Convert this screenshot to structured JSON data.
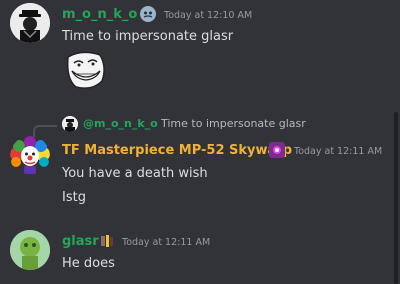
{
  "messages": [
    {
      "author": "m_o_n_k_o",
      "author_color": "#23a55a",
      "timestamp": "Today at 12:10 AM",
      "lines": [
        "Time to impersonate glasr"
      ],
      "attachment": "trollface-sticker"
    },
    {
      "reply_to": {
        "author": "@m_o_n_k_o",
        "text": "Time to impersonate glasr"
      },
      "author": "TF Masterpiece MP-52 Skywarp",
      "author_color": "#f0b232",
      "timestamp": "Today at 12:11 AM",
      "lines": [
        "You have a death wish",
        "Istg"
      ]
    },
    {
      "author": "glasr",
      "author_color": "#23a55a",
      "timestamp": "Today at 12:11 AM",
      "lines": [
        "He does"
      ]
    }
  ]
}
